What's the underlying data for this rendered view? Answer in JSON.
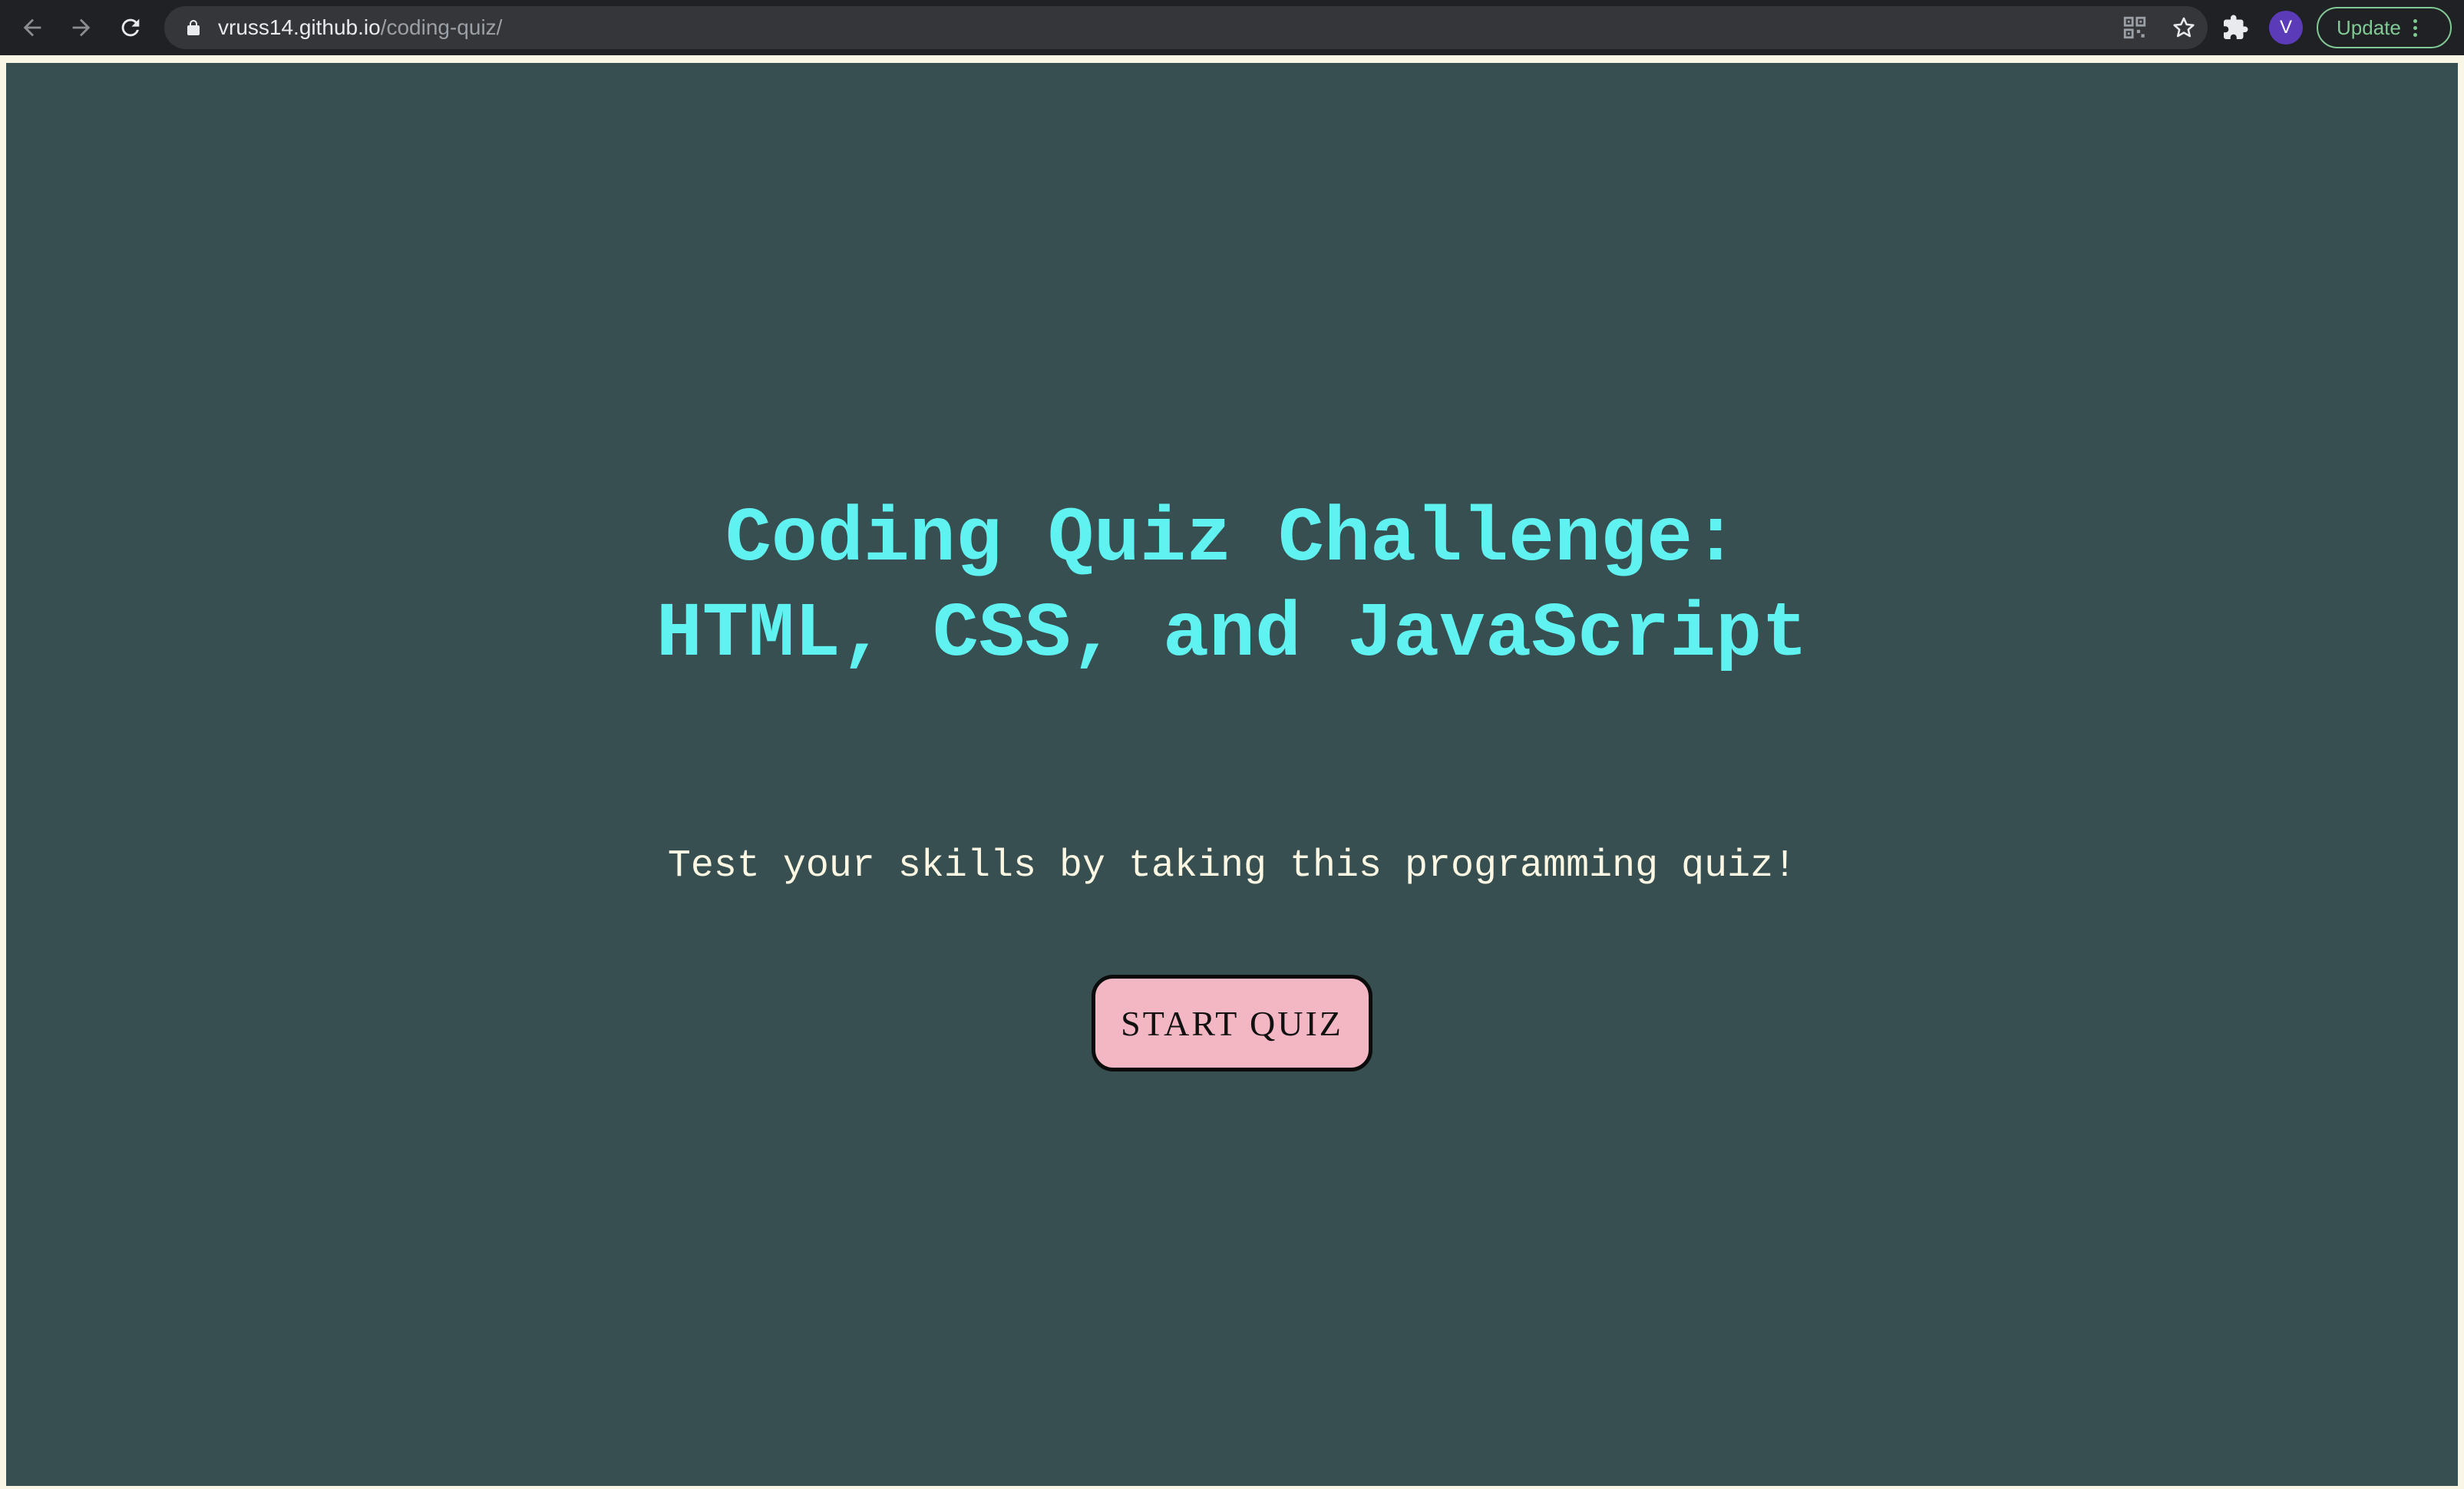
{
  "browser": {
    "url_host": "vruss14.github.io",
    "url_path": "/coding-quiz/",
    "avatar_letter": "V",
    "update_label": "Update",
    "icons": [
      "back-arrow-icon",
      "forward-arrow-icon",
      "reload-icon",
      "lock-icon",
      "qr-code-icon",
      "star-icon",
      "puzzle-icon",
      "kebab-menu-icon"
    ]
  },
  "quiz": {
    "title_line1": "Coding Quiz Challenge:",
    "title_line2": "HTML, CSS, and JavaScript",
    "subtitle": "Test your skills by taking this programming quiz!",
    "start_label": "START QUIZ"
  },
  "colors": {
    "page_background": "#374f50",
    "title": "#5ff2f0",
    "subtitle": "#fbf7e3",
    "button_fill": "#f3b6c3",
    "button_border": "#0b0b0b",
    "browser_chrome": "#202124"
  }
}
